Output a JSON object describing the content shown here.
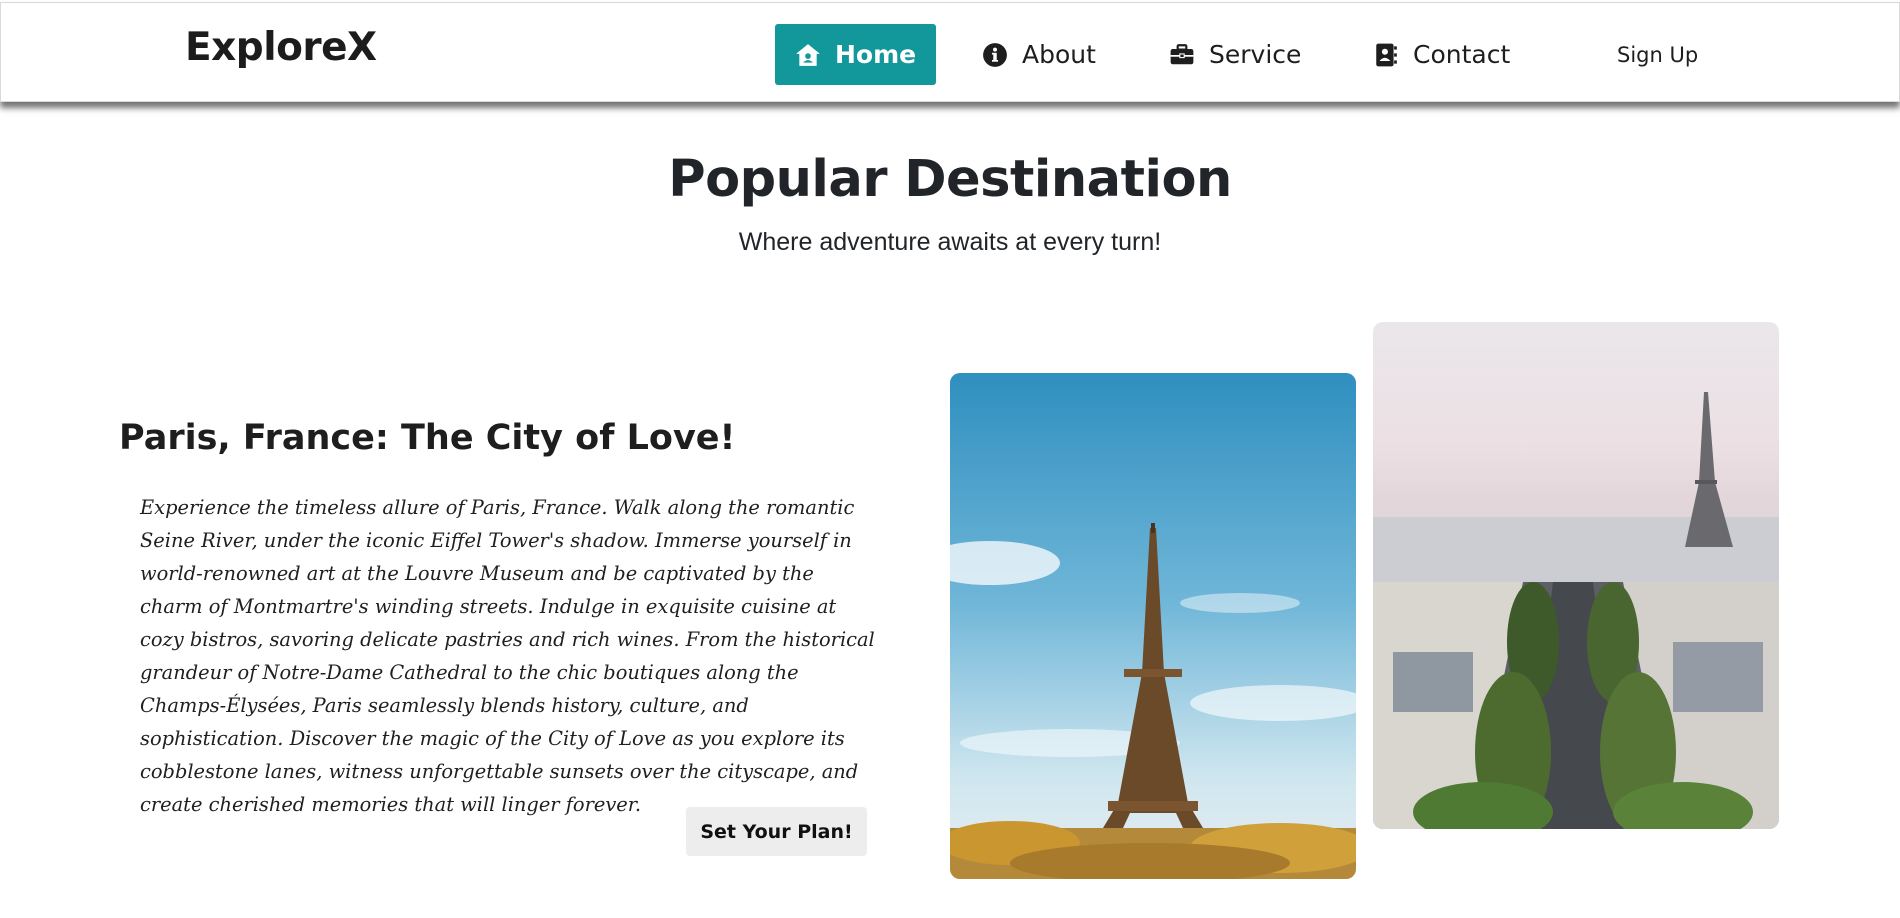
{
  "brand": "ExploreX",
  "nav": {
    "items": [
      {
        "label": "Home",
        "icon": "house-icon",
        "active": true
      },
      {
        "label": "About",
        "icon": "info-circle-icon",
        "active": false
      },
      {
        "label": "Service",
        "icon": "briefcase-icon",
        "active": false
      },
      {
        "label": "Contact",
        "icon": "contact-book-icon",
        "active": false
      }
    ],
    "signup": "Sign Up"
  },
  "section": {
    "title": "Popular Destination",
    "subtitle": "Where adventure awaits at every turn!"
  },
  "destination": {
    "heading": "Paris, France: The City of Love!",
    "description": "Experience the timeless allure of Paris, France. Walk along the romantic Seine River, under the iconic Eiffel Tower's shadow. Immerse yourself in world-renowned art at the Louvre Museum and be captivated by the charm of Montmartre's winding streets. Indulge in exquisite cuisine at cozy bistros, savoring delicate pastries and rich wines. From the historical grandeur of Notre-Dame Cathedral to the chic boutiques along the Champs-Élysées, Paris seamlessly blends history, culture, and sophistication. Discover the magic of the City of Love as you explore its cobblestone lanes, witness unforgettable sunsets over the cityscape, and create cherished memories that will linger forever.",
    "button": "Set Your Plan!"
  },
  "colors": {
    "accent": "#12979a",
    "button_bg": "#ededed",
    "text": "#212529"
  }
}
